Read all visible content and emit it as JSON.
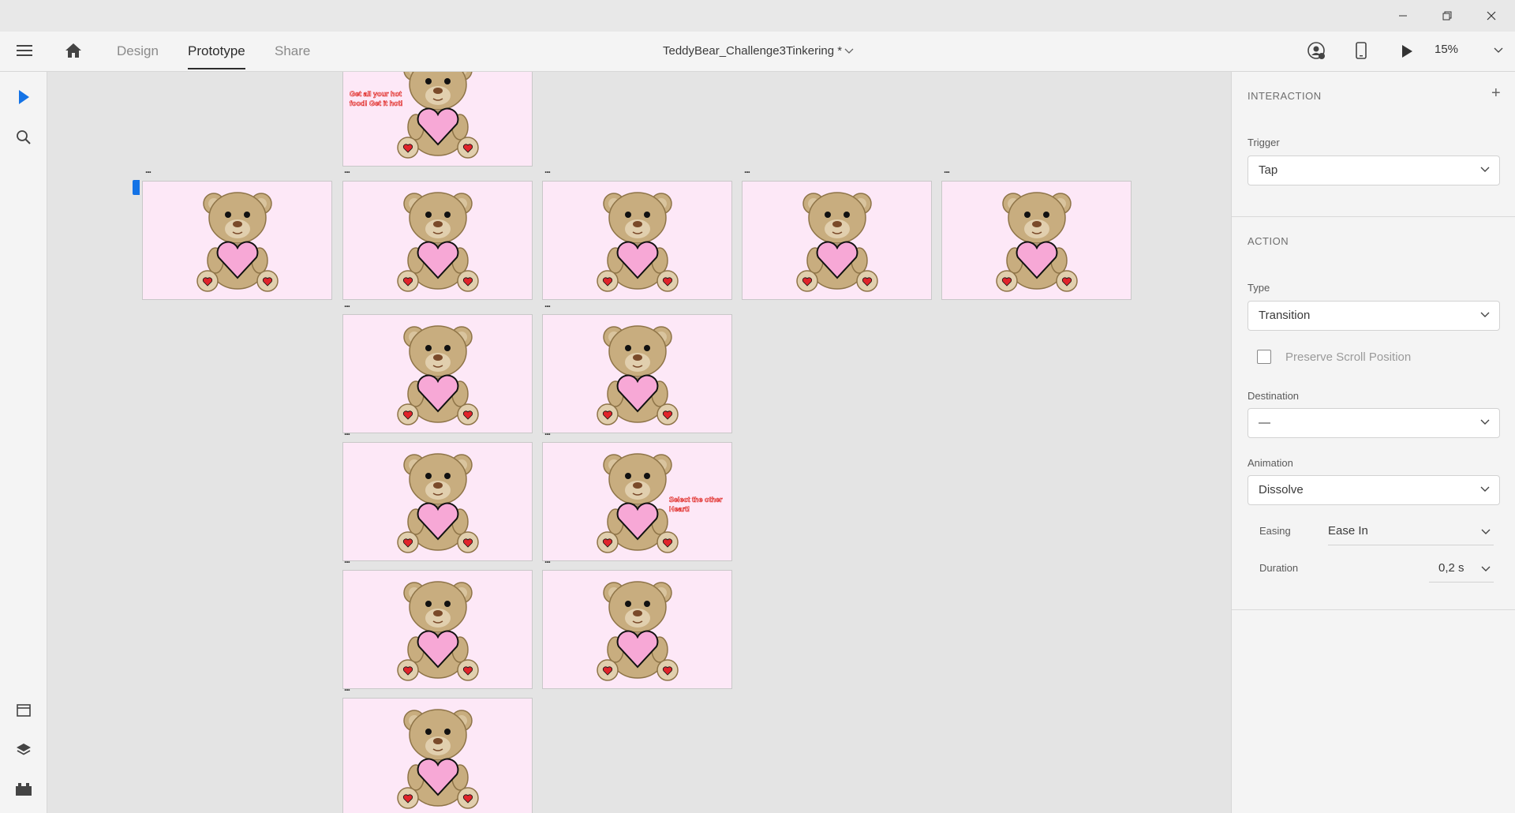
{
  "window": {
    "minimize_glyph": "—",
    "maximize_glyph": "❐",
    "close_glyph": "✕"
  },
  "toolbar": {
    "menu_icon": "hamburger-icon",
    "home_icon": "home-icon",
    "tabs": [
      {
        "label": "Design"
      },
      {
        "label": "Prototype"
      },
      {
        "label": "Share"
      }
    ],
    "document_title": "TeddyBear_Challenge3Tinkering *",
    "zoom": "15%"
  },
  "canvas": {
    "artboard_dots": "...",
    "caption_top": "Get all your hot food! Get it hot!",
    "caption_side": "Select the other Heart!"
  },
  "panel": {
    "interaction_title": "INTERACTION",
    "add_glyph": "+",
    "trigger_label": "Trigger",
    "trigger_value": "Tap",
    "action_title": "ACTION",
    "type_label": "Type",
    "type_value": "Transition",
    "preserve_scroll_label": "Preserve Scroll Position",
    "preserve_scroll_checked": false,
    "destination_label": "Destination",
    "destination_value": "—",
    "animation_label": "Animation",
    "animation_value": "Dissolve",
    "easing_label": "Easing",
    "easing_value": "Ease In",
    "duration_label": "Duration",
    "duration_value": "0,2 s"
  },
  "colors": {
    "accent": "#1473e6",
    "artboard_bg": "#fde8f7",
    "bear_fur": "#c8ad7f",
    "heart_pink": "#f7a8d6",
    "heart_red": "#e0242b"
  }
}
